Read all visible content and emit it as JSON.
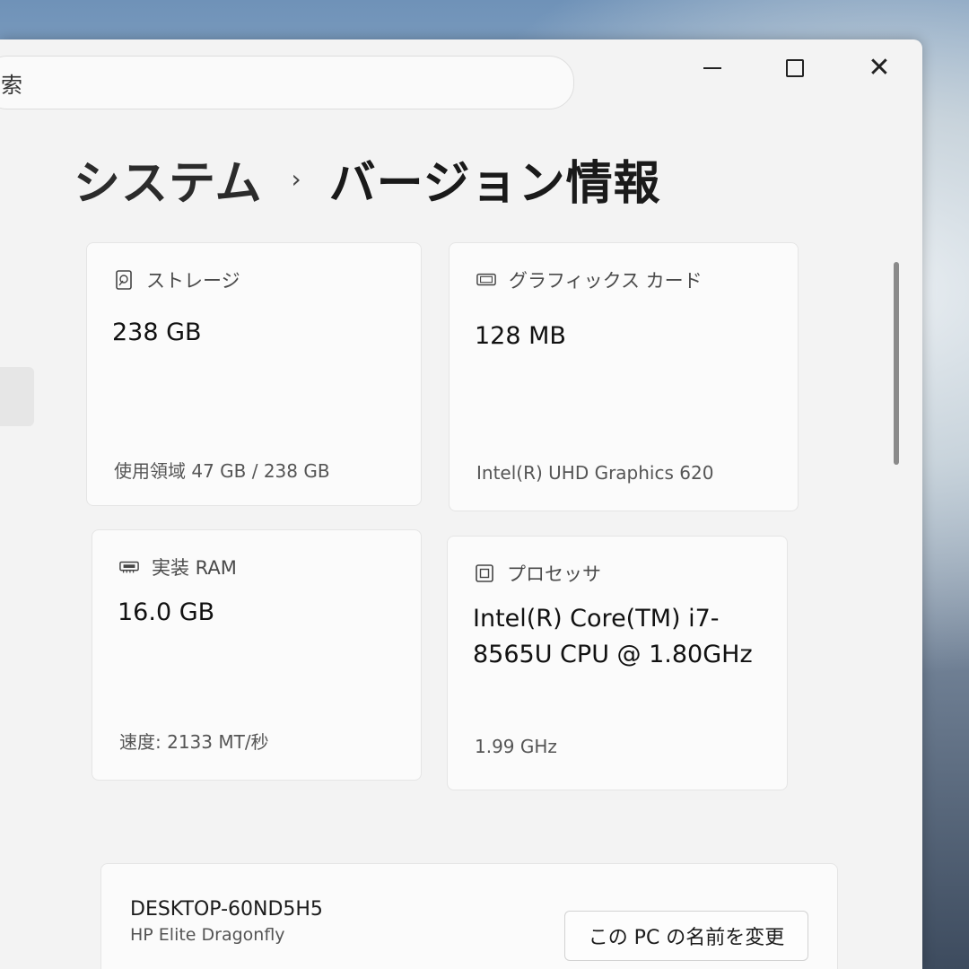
{
  "search": {
    "text": "索"
  },
  "window_controls": {
    "minimize": "minimize",
    "maximize": "maximize",
    "close": "✕"
  },
  "breadcrumb": {
    "parent": "システム",
    "separator": "›",
    "current": "バージョン情報"
  },
  "cards": {
    "storage": {
      "title": "ストレージ",
      "value": "238 GB",
      "detail": "使用領域 47 GB / 238 GB",
      "icon": "storage-drive-icon"
    },
    "graphics": {
      "title": "グラフィックス カード",
      "value": "128 MB",
      "detail": "Intel(R) UHD Graphics 620",
      "icon": "display-adapter-icon"
    },
    "ram": {
      "title": "実装 RAM",
      "value": "16.0 GB",
      "detail": "速度: 2133 MT/秒",
      "icon": "memory-icon"
    },
    "processor": {
      "title": "プロセッサ",
      "value": "Intel(R) Core(TM) i7-8565U CPU @ 1.80GHz",
      "detail": "1.99 GHz",
      "icon": "cpu-chip-icon"
    }
  },
  "device": {
    "name": "DESKTOP-60ND5H5",
    "model": "HP Elite Dragonfly",
    "rename_button": "この PC の名前を変更"
  }
}
